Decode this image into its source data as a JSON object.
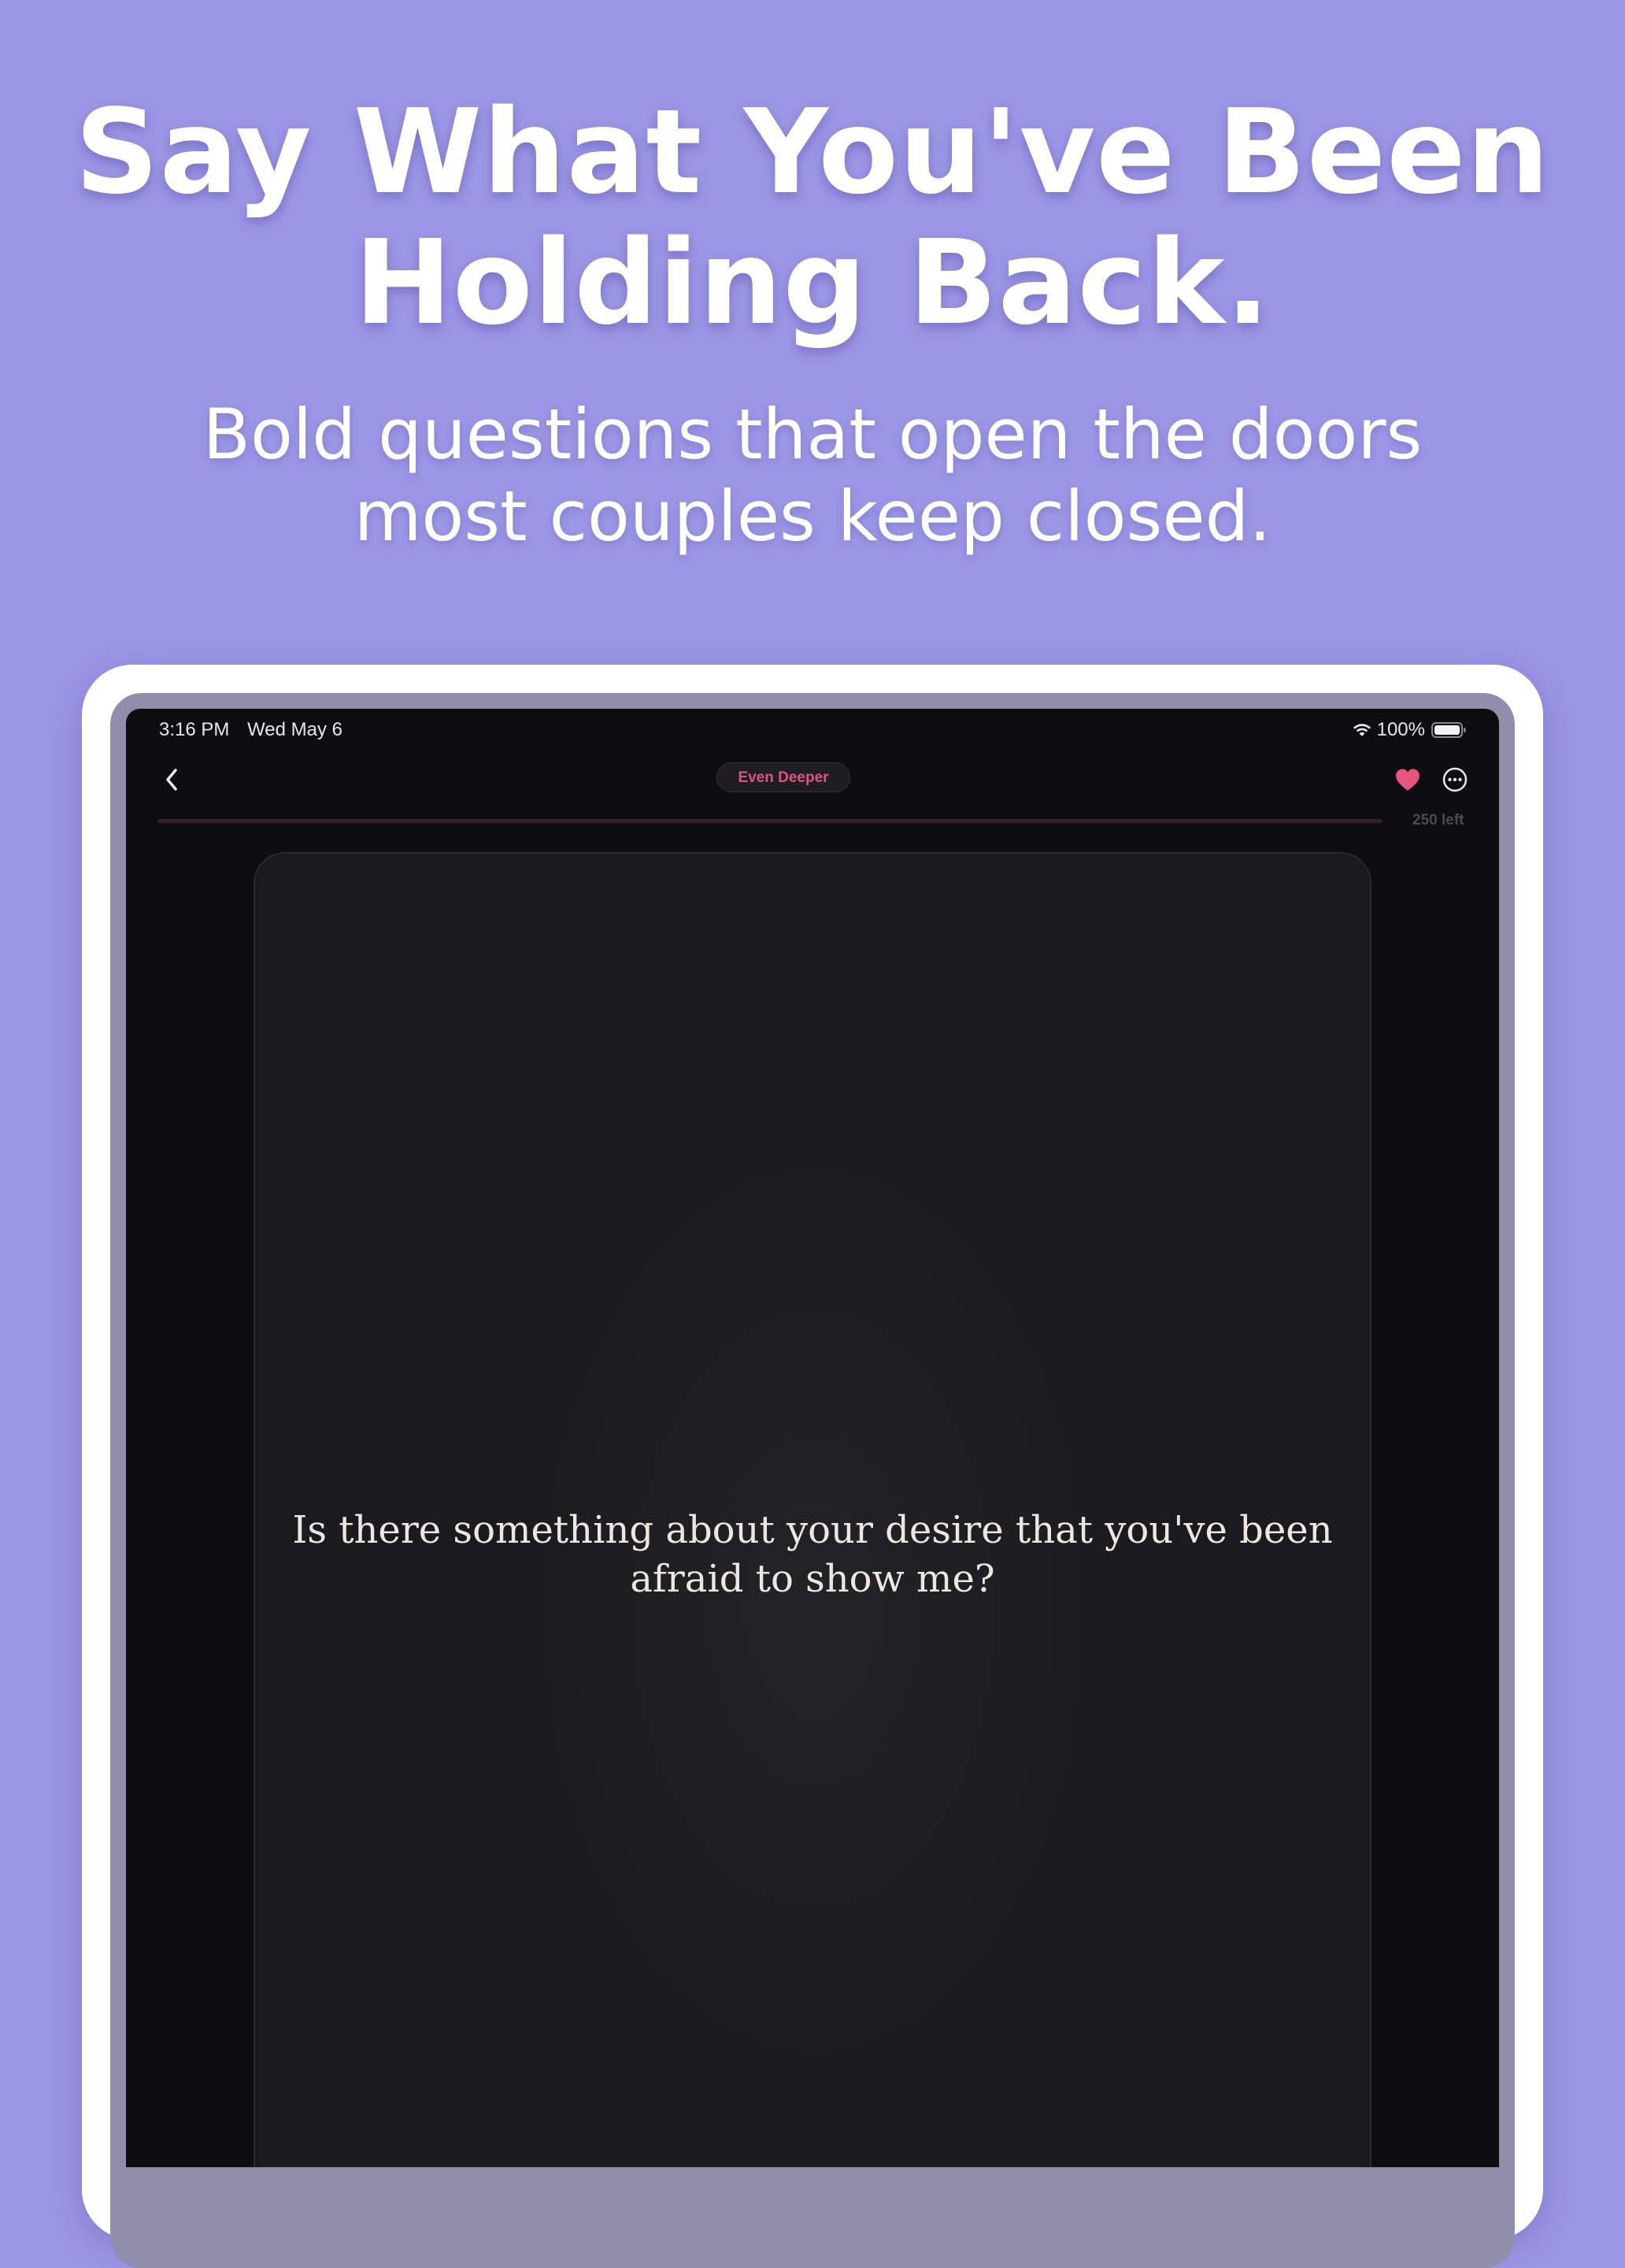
{
  "marketing": {
    "headline_line1": "Say What You've Been",
    "headline_line2": "Holding Back.",
    "subhead_line1": "Bold questions that open the doors",
    "subhead_line2": "most couples keep closed."
  },
  "status_bar": {
    "time": "3:16 PM",
    "date": "Wed May 6",
    "battery": "100%"
  },
  "nav": {
    "category": "Even Deeper",
    "back_icon": "chevron-left-icon",
    "favorite_icon": "heart-icon",
    "more_icon": "ellipsis-circle-icon"
  },
  "progress": {
    "remaining_label": "250 left",
    "fraction": 0
  },
  "card": {
    "question": "Is there something about your desire that you've been afraid to show me?"
  },
  "colors": {
    "background": "#9c96e6",
    "screen": "#0e0e12",
    "card": "#1b1b1f",
    "accent_pink": "#d7587c",
    "heart": "#e8537f"
  }
}
